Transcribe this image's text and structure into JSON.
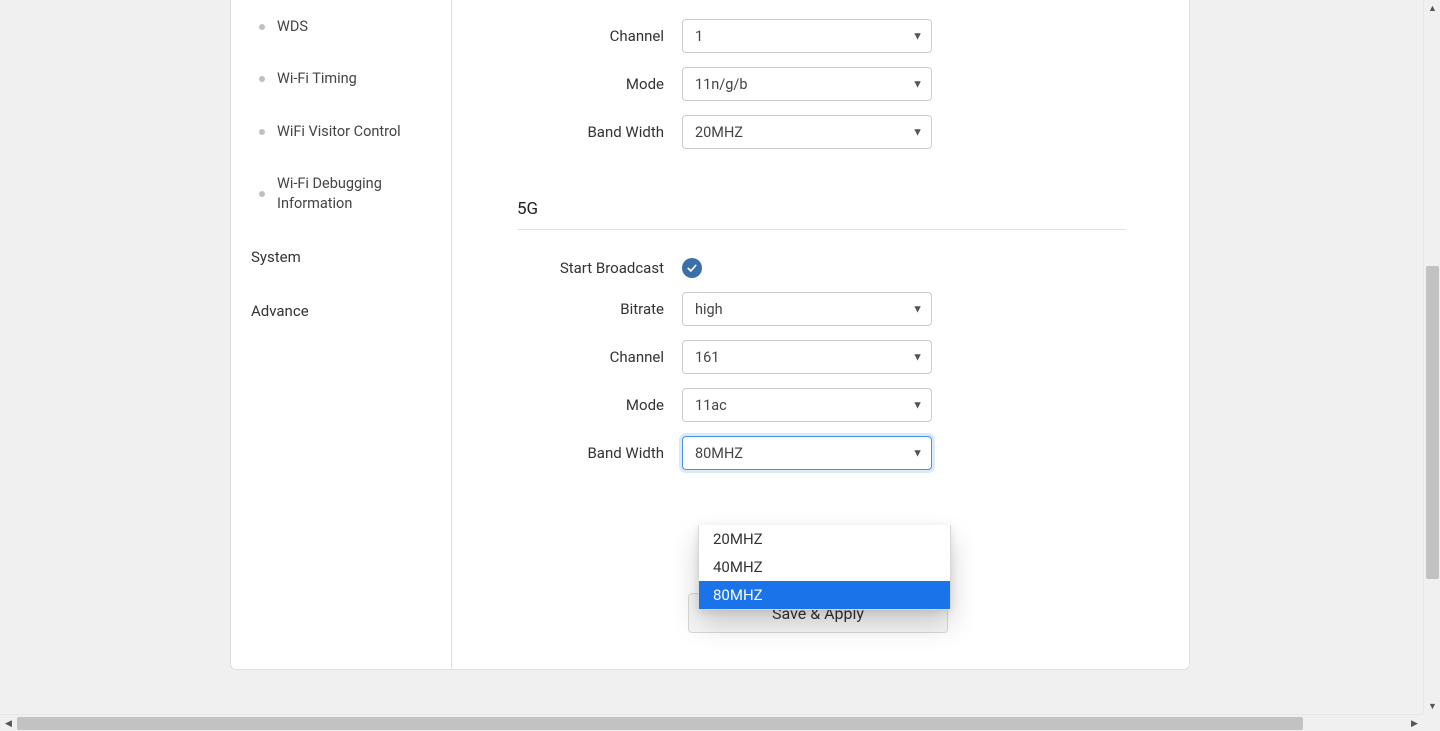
{
  "sidebar": {
    "items": [
      {
        "label": "WDS"
      },
      {
        "label": "Wi-Fi Timing"
      },
      {
        "label": "WiFi Visitor Control"
      },
      {
        "label": "Wi-Fi Debugging Information"
      }
    ],
    "sections": [
      {
        "label": "System"
      },
      {
        "label": "Advance"
      }
    ]
  },
  "form24": {
    "channel": {
      "label": "Channel",
      "value": "1"
    },
    "mode": {
      "label": "Mode",
      "value": "11n/g/b"
    },
    "bandwidth": {
      "label": "Band Width",
      "value": "20MHZ"
    }
  },
  "section5g": {
    "title": "5G",
    "broadcast": {
      "label": "Start Broadcast"
    },
    "bitrate": {
      "label": "Bitrate",
      "value": "high"
    },
    "channel": {
      "label": "Channel",
      "value": "161"
    },
    "mode": {
      "label": "Mode",
      "value": "11ac"
    },
    "bandwidth": {
      "label": "Band Width",
      "value": "80MHZ",
      "options": [
        "20MHZ",
        "40MHZ",
        "80MHZ"
      ],
      "selected_index": 2
    }
  },
  "actions": {
    "save": "Save & Apply"
  }
}
